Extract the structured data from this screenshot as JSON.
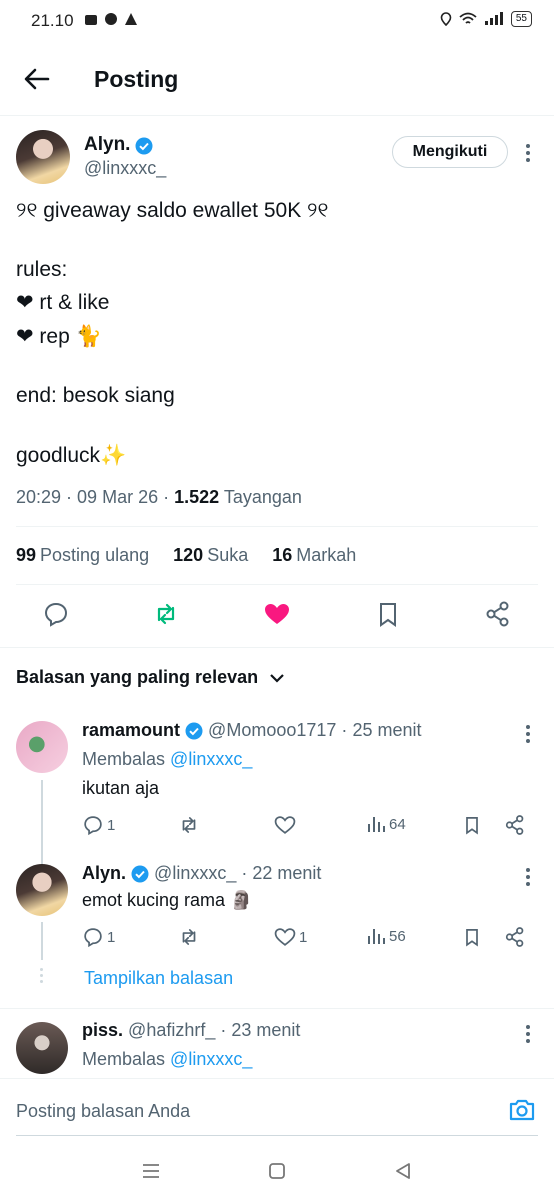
{
  "status_bar": {
    "time": "21.10",
    "battery": "55"
  },
  "header": {
    "title": "Posting"
  },
  "post": {
    "author_name": "Alyn.",
    "handle": "@linxxxc_",
    "follow_label": "Mengikuti",
    "lines": [
      "୨୧ giveaway saldo ewallet 50K ୨୧",
      "rules:",
      "❤ rt & like",
      "❤ rep 🐈",
      "end: besok siang",
      "goodluck✨"
    ],
    "time": "20:29",
    "date": "09 Mar 26",
    "views_count": "1.522",
    "views_label": "Tayangan",
    "reposts_count": "99",
    "reposts_label": "Posting ulang",
    "likes_count": "120",
    "likes_label": "Suka",
    "bookmarks_count": "16",
    "bookmarks_label": "Markah"
  },
  "replies_filter": "Balasan yang paling relevan",
  "replies": [
    {
      "name": "ramamount",
      "handle": "@Momooo1717",
      "time": "25 menit",
      "replying_prefix": "Membalas",
      "replying_to": "@linxxxc_",
      "text": "ikutan aja",
      "reply_count": "1",
      "like_count": "",
      "views": "64"
    },
    {
      "name": "Alyn.",
      "handle": "@linxxxc_",
      "time": "22 menit",
      "text": "emot kucing rama 🗿",
      "reply_count": "1",
      "like_count": "1",
      "views": "56"
    },
    {
      "name": "piss.",
      "handle": "@hafizhrf_",
      "time": "23 menit",
      "replying_prefix": "Membalas",
      "replying_to": "@linxxxc_"
    }
  ],
  "show_replies": "Tampilkan balasan",
  "composer": {
    "placeholder": "Posting balasan Anda"
  },
  "colors": {
    "accent": "#1d9bf0",
    "like": "#f91880",
    "repost": "#00ba7c",
    "muted": "#536471"
  }
}
